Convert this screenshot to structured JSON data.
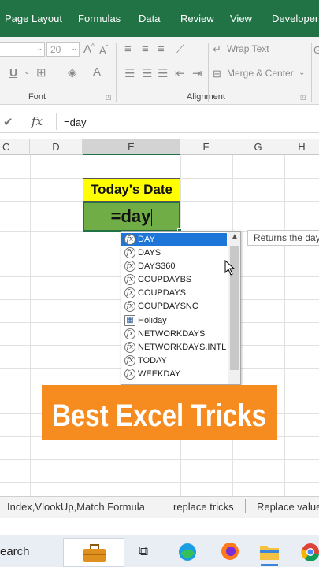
{
  "ribbon": {
    "tabs": [
      "Page Layout",
      "Formulas",
      "Data",
      "Review",
      "View",
      "Developer"
    ],
    "font_size": "20",
    "groups": {
      "font": "Font",
      "alignment": "Alignment"
    },
    "wrap_text": "Wrap Text",
    "merge_center": "Merge & Center"
  },
  "formula_bar": {
    "content": "=day"
  },
  "columns": [
    "C",
    "D",
    "E",
    "F",
    "G",
    "H"
  ],
  "cells": {
    "header": "Today's Date",
    "editing": "=day"
  },
  "autocomplete": {
    "items": [
      "DAY",
      "DAYS",
      "DAYS360",
      "COUPDAYBS",
      "COUPDAYS",
      "COUPDAYSNC",
      "Holiday",
      "NETWORKDAYS",
      "NETWORKDAYS.INTL",
      "TODAY",
      "WEEKDAY"
    ],
    "selected": "DAY",
    "tooltip": "Returns the day"
  },
  "banner": {
    "text": "Best Excel Tricks"
  },
  "sheet_tabs": [
    "Index,VlookUp,Match Formula",
    "replace tricks",
    "Replace value"
  ],
  "taskbar": {
    "search": "earch"
  },
  "colors": {
    "ribbon_green": "#217346",
    "cell_yellow": "#ffff00",
    "cell_green": "#70ad47",
    "selection_blue": "#1e75d8",
    "banner_orange": "#f68b1f"
  }
}
